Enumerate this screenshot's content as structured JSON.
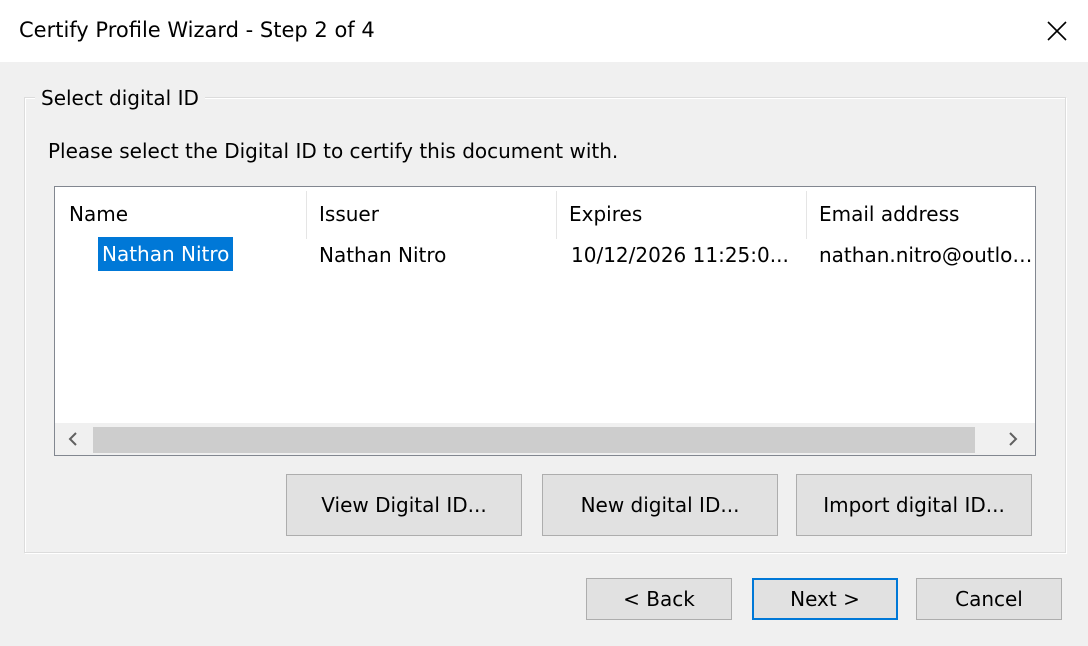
{
  "window": {
    "title": "Certify Profile Wizard - Step 2 of 4",
    "close_icon": "close-icon"
  },
  "group": {
    "legend": "Select digital ID",
    "instruction": "Please select the Digital ID to certify this document with."
  },
  "list": {
    "columns": [
      "Name",
      "Issuer",
      "Expires",
      "Email address"
    ],
    "rows": [
      {
        "name": "Nathan Nitro",
        "issuer": "Nathan Nitro",
        "expires": "10/12/2026 11:25:0...",
        "email": "nathan.nitro@outloo..."
      }
    ],
    "selected_row": 0,
    "colors": {
      "selection": "#0078d7"
    }
  },
  "id_buttons": {
    "view": "View Digital ID...",
    "new": "New digital ID...",
    "import": "Import digital ID..."
  },
  "nav_buttons": {
    "back": "< Back",
    "next": "Next >",
    "cancel": "Cancel"
  }
}
